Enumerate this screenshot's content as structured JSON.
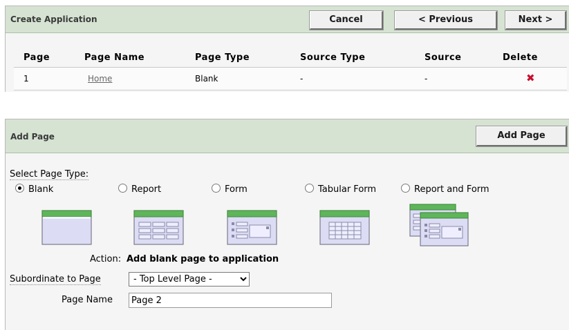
{
  "create_region": {
    "title": "Create Application",
    "buttons": {
      "cancel": "Cancel",
      "previous": "< Previous",
      "next": "Next >"
    },
    "table": {
      "headers": [
        "Page",
        "Page Name",
        "Page Type",
        "Source Type",
        "Source",
        "Delete"
      ],
      "rows": [
        {
          "page": "1",
          "page_name": "Home",
          "page_type": "Blank",
          "source_type": "-",
          "source": "-",
          "delete_icon": "delete-x-icon"
        }
      ]
    }
  },
  "add_region": {
    "title": "Add Page",
    "add_button": "Add Page",
    "select_page_type_label": "Select Page Type:",
    "page_types": [
      {
        "label": "Blank",
        "checked": true,
        "icon": "blank-page-icon"
      },
      {
        "label": "Report",
        "checked": false,
        "icon": "report-page-icon"
      },
      {
        "label": "Form",
        "checked": false,
        "icon": "form-page-icon"
      },
      {
        "label": "Tabular Form",
        "checked": false,
        "icon": "tabular-form-page-icon"
      },
      {
        "label": "Report and Form",
        "checked": false,
        "icon": "report-and-form-page-icon"
      }
    ],
    "action_label": "Action:",
    "action_value": "Add blank page to application",
    "subordinate_label": "Subordinate to Page",
    "subordinate_value": "- Top Level Page -",
    "page_name_label": "Page Name",
    "page_name_value": "Page 2"
  },
  "colors": {
    "region_header": "#d6e3d2",
    "region_body": "#f5f5f5",
    "delete_icon": "#c8102e",
    "icon_header_green": "#5fb55a",
    "icon_body_lavender": "#dcdcf5"
  }
}
